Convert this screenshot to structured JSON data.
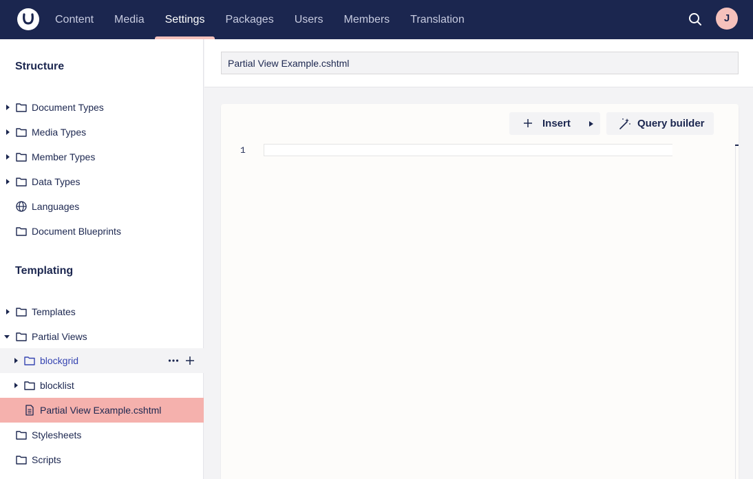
{
  "topbar": {
    "logo": "umbraco-logo",
    "nav": [
      {
        "label": "Content"
      },
      {
        "label": "Media"
      },
      {
        "label": "Settings",
        "active": true
      },
      {
        "label": "Packages"
      },
      {
        "label": "Users"
      },
      {
        "label": "Members"
      },
      {
        "label": "Translation"
      }
    ],
    "search_icon": "search-icon",
    "avatar_initial": "J",
    "colors": {
      "bar": "#1b264f",
      "accent": "#f5c1bc"
    }
  },
  "sidebar": {
    "structure_title": "Structure",
    "structure_items": [
      {
        "label": "Document Types",
        "icon": "folder-icon",
        "expandable": true
      },
      {
        "label": "Media Types",
        "icon": "folder-icon",
        "expandable": true
      },
      {
        "label": "Member Types",
        "icon": "folder-icon",
        "expandable": true
      },
      {
        "label": "Data Types",
        "icon": "folder-icon",
        "expandable": true
      },
      {
        "label": "Languages",
        "icon": "globe-icon",
        "expandable": false
      },
      {
        "label": "Document Blueprints",
        "icon": "folder-icon",
        "expandable": false
      }
    ],
    "templating_title": "Templating",
    "templating_items": [
      {
        "label": "Templates",
        "icon": "folder-icon",
        "expandable": true
      },
      {
        "label": "Partial Views",
        "icon": "folder-icon",
        "expanded": true
      },
      {
        "label": "blockgrid",
        "icon": "folder-icon",
        "expandable": true,
        "hover": true
      },
      {
        "label": "blocklist",
        "icon": "folder-icon",
        "expandable": true
      },
      {
        "label": "Partial View Example.cshtml",
        "icon": "document-icon",
        "selected": true
      },
      {
        "label": "Stylesheets",
        "icon": "folder-icon",
        "expandable": false
      },
      {
        "label": "Scripts",
        "icon": "folder-icon",
        "expandable": false
      }
    ],
    "row_actions": [
      "more-icon",
      "plus-icon"
    ]
  },
  "editor": {
    "name_value": "Partial View Example.cshtml",
    "insert_label": "Insert",
    "query_label": "Query builder",
    "line_numbers": [
      "1"
    ]
  }
}
